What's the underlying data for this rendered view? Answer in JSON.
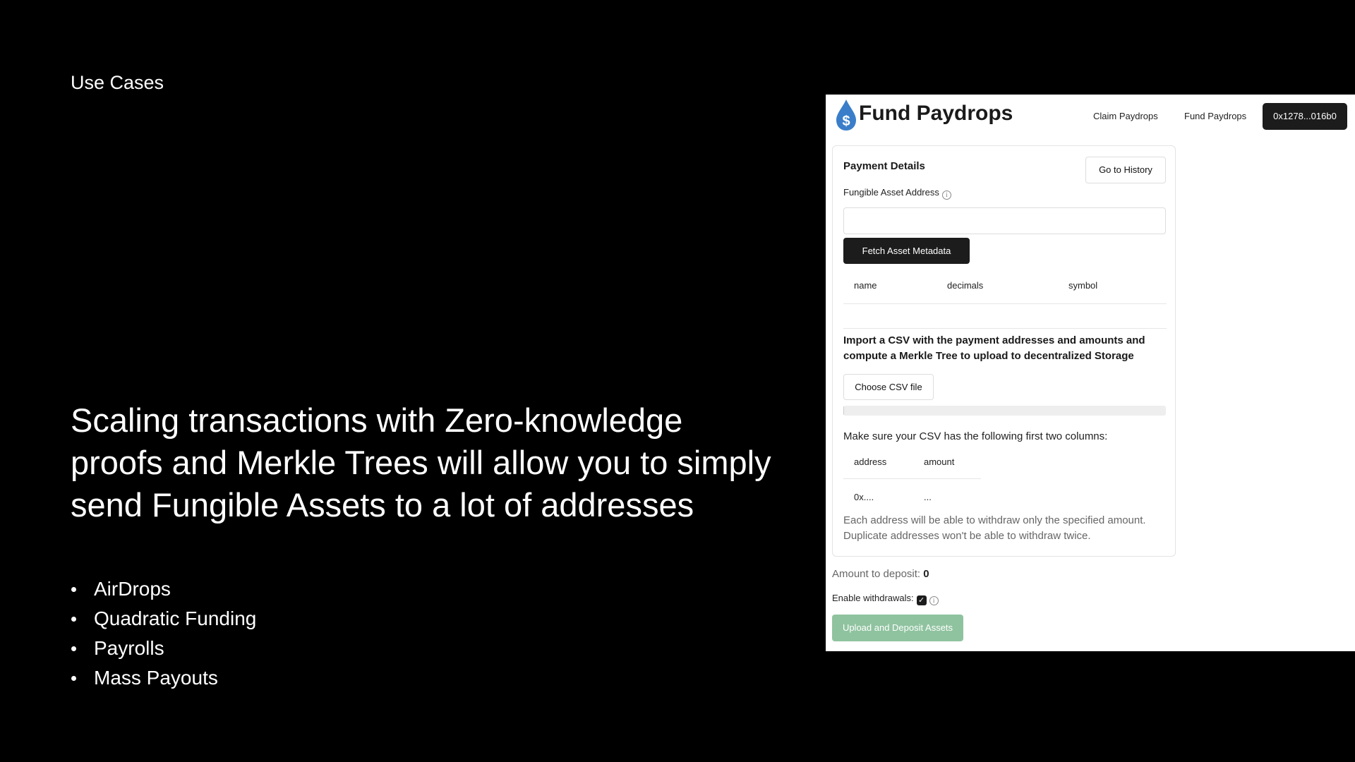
{
  "slide": {
    "heading": "Use Cases",
    "main_text": "Scaling transactions with Zero-knowledge proofs and Merkle Trees will allow you to simply send Fungible Assets to a lot of addresses",
    "bullets": [
      "AirDrops",
      "Quadratic Funding",
      "Payrolls",
      "Mass Payouts"
    ]
  },
  "app": {
    "title": "Fund Paydrops",
    "logo_icon": "water-drop-dollar-icon",
    "brand_color": "#3a7ec9",
    "nav": {
      "claim": "Claim Paydrops",
      "fund": "Fund Paydrops",
      "wallet": "0x1278...016b0"
    },
    "payment_details": {
      "title": "Payment Details",
      "history_button": "Go to History",
      "asset_address_label": "Fungible Asset Address",
      "asset_address_value": "",
      "fetch_button": "Fetch Asset Metadata",
      "metadata_columns": [
        "name",
        "decimals",
        "symbol"
      ],
      "import_text": "Import a CSV with the payment addresses and amounts and compute a Merkle Tree to upload to decentralized Storage",
      "csv_button": "Choose CSV file",
      "upload_progress": 0,
      "csv_note": "Make sure your CSV has the following first two columns:",
      "csv_columns": [
        "address",
        "amount"
      ],
      "csv_example": [
        "0x....",
        "..."
      ],
      "withdraw_note": "Each address will be able to withdraw only the specified amount. Duplicate addresses won't be able to withdraw twice."
    },
    "deposit": {
      "label": "Amount to deposit:",
      "value": "0"
    },
    "withdrawals": {
      "label": "Enable withdrawals:",
      "checked": true
    },
    "upload_button": "Upload and Deposit Assets",
    "upload_button_color": "#8fc39f"
  }
}
